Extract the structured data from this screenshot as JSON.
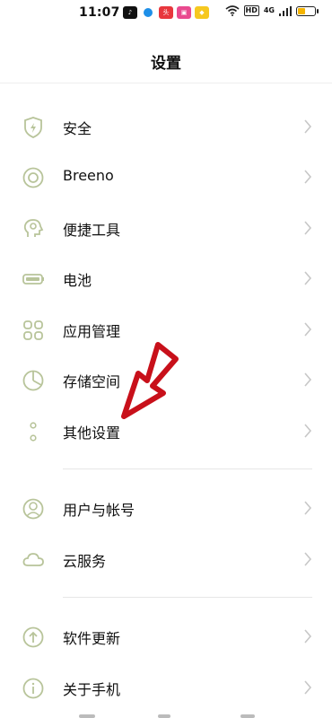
{
  "status": {
    "time": "11:07",
    "hd": "HD",
    "network": "4G"
  },
  "header": {
    "title": "设置"
  },
  "items": [
    {
      "label": "安全",
      "icon": "shield-icon"
    },
    {
      "label": "Breeno",
      "icon": "circle-target-icon"
    },
    {
      "label": "便捷工具",
      "icon": "head-gear-icon"
    },
    {
      "label": "电池",
      "icon": "battery-icon"
    },
    {
      "label": "应用管理",
      "icon": "app-grid-icon"
    },
    {
      "label": "存储空间",
      "icon": "pie-chart-icon"
    },
    {
      "label": "其他设置",
      "icon": "dots-icon"
    },
    {
      "label": "用户与帐号",
      "icon": "user-icon"
    },
    {
      "label": "云服务",
      "icon": "cloud-icon"
    },
    {
      "label": "软件更新",
      "icon": "update-arrow-icon"
    },
    {
      "label": "关于手机",
      "icon": "info-icon"
    }
  ],
  "colors": {
    "icon": "#b8c49a",
    "chevron": "#c7c7c7",
    "arrow": "#c8101a"
  }
}
